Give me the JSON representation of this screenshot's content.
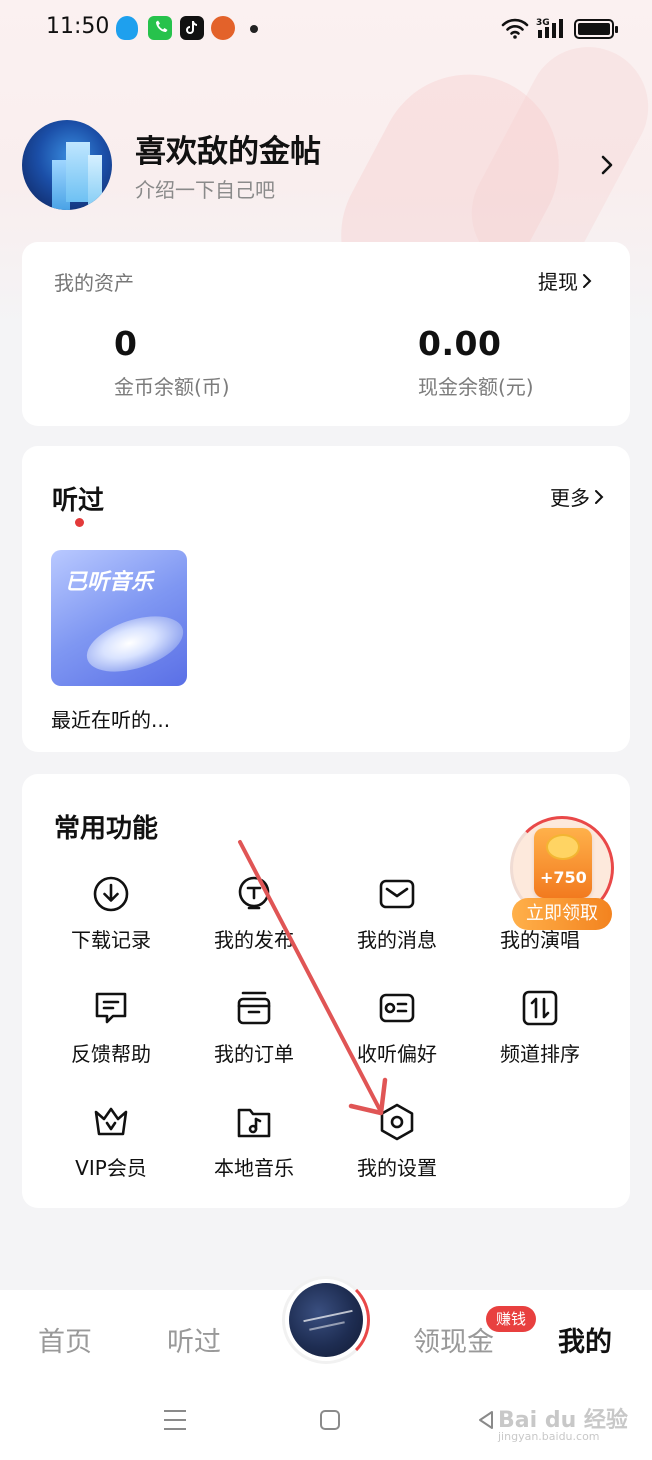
{
  "status_bar": {
    "time": "11:50",
    "network": "3G",
    "icons": [
      "qq-icon",
      "phone-icon",
      "tiktok-icon",
      "game-icon",
      "wifi-icon",
      "signal-icon",
      "battery-icon"
    ]
  },
  "profile": {
    "name": "喜欢敌的金帖",
    "bio": "介绍一下自己吧"
  },
  "assets": {
    "title": "我的资产",
    "withdraw_label": "提现",
    "coin_value": "0",
    "coin_label": "金币余额(币)",
    "cash_value": "0.00",
    "cash_label": "现金余额(元)"
  },
  "history": {
    "title": "听过",
    "more_label": "更多",
    "album_cover_text": "已听音乐",
    "album_caption": "最近在听的..."
  },
  "features": {
    "title": "常用功能",
    "items": [
      {
        "label": "下载记录",
        "icon": "download-icon"
      },
      {
        "label": "我的发布",
        "icon": "publish-icon"
      },
      {
        "label": "我的消息",
        "icon": "message-icon"
      },
      {
        "label": "我的演唱",
        "icon": "sing-icon"
      },
      {
        "label": "反馈帮助",
        "icon": "feedback-icon"
      },
      {
        "label": "我的订单",
        "icon": "order-icon"
      },
      {
        "label": "收听偏好",
        "icon": "preference-icon"
      },
      {
        "label": "频道排序",
        "icon": "sort-icon"
      },
      {
        "label": "VIP会员",
        "icon": "vip-crown-icon"
      },
      {
        "label": "本地音乐",
        "icon": "local-music-icon"
      },
      {
        "label": "我的设置",
        "icon": "settings-icon"
      }
    ],
    "promo": {
      "amount": "+750",
      "claim_label": "立即领取"
    }
  },
  "bottom_nav": {
    "items": [
      {
        "label": "首页"
      },
      {
        "label": "听过"
      },
      {
        "label": "领现金"
      },
      {
        "label": "我的"
      }
    ],
    "earn_badge": "赚钱",
    "active": "我的"
  },
  "watermark": {
    "text": "Bai du 经验",
    "url": "jingyan.baidu.com"
  },
  "colors": {
    "accent_red": "#e8403f",
    "promo_orange": "#f3831f",
    "annotation_arrow": "#e05555"
  }
}
